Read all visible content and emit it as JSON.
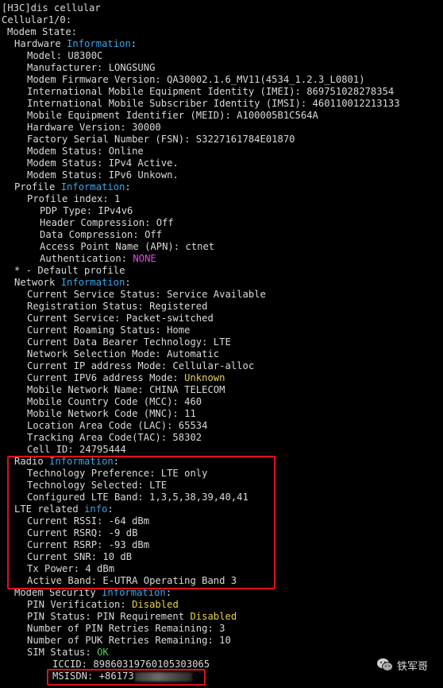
{
  "lines": [
    {
      "indent": "i0",
      "text": "[H3C]dis cellular"
    },
    {
      "indent": "i0",
      "text": "Cellular1/0:"
    },
    {
      "indent": "i1",
      "text": "Modem State:"
    },
    {
      "indent": "i2",
      "pre": "Hardware ",
      "hl": "Information",
      "hlc": "blue",
      "post": ":"
    },
    {
      "indent": "i3",
      "text": "Model: U8300C"
    },
    {
      "indent": "i3",
      "text": "Manufacturer: LONGSUNG"
    },
    {
      "indent": "i3",
      "text": "Modem Firmware Version: QA30002.1.6_MV11(4534_1.2.3_L0801)"
    },
    {
      "indent": "i3",
      "text": "International Mobile Equipment Identity (IMEI): 869751028278354"
    },
    {
      "indent": "i3",
      "text": "International Mobile Subscriber Identity (IMSI): 460110012213133"
    },
    {
      "indent": "i3",
      "text": "Mobile Equipment Identifier (MEID): A100005B1C564A"
    },
    {
      "indent": "i3",
      "text": "Hardware Version: 30000"
    },
    {
      "indent": "i3",
      "text": "Factory Serial Number (FSN): S3227161784E01870"
    },
    {
      "indent": "i3",
      "text": "Modem Status: Online"
    },
    {
      "indent": "i3",
      "text": "Modem Status: IPv4 Active."
    },
    {
      "indent": "i3",
      "text": "Modem Status: IPv6 Unkown."
    },
    {
      "indent": "i2",
      "pre": "Profile ",
      "hl": "Information",
      "hlc": "blue",
      "post": ":"
    },
    {
      "indent": "i3",
      "text": "Profile index: 1"
    },
    {
      "indent": "i4",
      "text": "PDP Type: IPv4v6"
    },
    {
      "indent": "i4",
      "text": "Header Compression: Off"
    },
    {
      "indent": "i4",
      "text": "Data Compression: Off"
    },
    {
      "indent": "i4",
      "text": "Access Point Name (APN): ctnet"
    },
    {
      "indent": "i4",
      "pre": "Authentication: ",
      "hl": "NONE",
      "hlc": "magenta",
      "post": ""
    },
    {
      "indent": "i2",
      "text": "* - Default profile"
    },
    {
      "indent": "i2",
      "pre": "Network ",
      "hl": "Information",
      "hlc": "blue",
      "post": ":"
    },
    {
      "indent": "i3",
      "text": "Current Service Status: Service Available"
    },
    {
      "indent": "i3",
      "text": "Registration Status: Registered"
    },
    {
      "indent": "i3",
      "text": "Current Service: Packet-switched"
    },
    {
      "indent": "i3",
      "text": "Current Roaming Status: Home"
    },
    {
      "indent": "i3",
      "text": "Current Data Bearer Technology: LTE"
    },
    {
      "indent": "i3",
      "text": "Network Selection Mode: Automatic"
    },
    {
      "indent": "i3",
      "text": "Current IP address Mode: Cellular-alloc"
    },
    {
      "indent": "i3",
      "pre": "Current IPV6 address Mode: ",
      "hl": "Unknown",
      "hlc": "yellow",
      "post": ""
    },
    {
      "indent": "i3",
      "text": "Mobile Network Name: CHINA TELECOM"
    },
    {
      "indent": "i3",
      "text": "Mobile Country Code (MCC): 460"
    },
    {
      "indent": "i3",
      "text": "Mobile Network Code (MNC): 11"
    },
    {
      "indent": "i3",
      "text": "Location Area Code (LAC): 65534"
    },
    {
      "indent": "i3",
      "text": "Tracking Area Code(TAC): 58302"
    },
    {
      "indent": "i3",
      "text": "Cell ID: 24795444"
    },
    {
      "indent": "i2",
      "pre": "Radio ",
      "hl": "Information",
      "hlc": "blue",
      "post": ":"
    },
    {
      "indent": "i3",
      "text": "Technology Preference: LTE only"
    },
    {
      "indent": "i3",
      "text": "Technology Selected: LTE"
    },
    {
      "indent": "i3",
      "text": "Configured LTE Band: 1,3,5,38,39,40,41"
    },
    {
      "indent": "i2",
      "pre": "LTE related ",
      "hl": "info",
      "hlc": "blue",
      "post": ":"
    },
    {
      "indent": "i3",
      "text": "Current RSSI: -64 dBm"
    },
    {
      "indent": "i3",
      "text": "Current RSRQ: -9 dB"
    },
    {
      "indent": "i3",
      "text": "Current RSRP: -93 dBm"
    },
    {
      "indent": "i3",
      "text": "Current SNR: 10 dB"
    },
    {
      "indent": "i3",
      "text": "Tx Power: 4 dBm"
    },
    {
      "indent": "i3",
      "text": "Active Band: E-UTRA Operating Band 3"
    },
    {
      "indent": "i2",
      "pre": "Modem Security ",
      "hl": "Information",
      "hlc": "blue",
      "post": ":"
    },
    {
      "indent": "i3",
      "pre": "PIN Verification: ",
      "hl": "Disabled",
      "hlc": "yellow",
      "post": ""
    },
    {
      "indent": "i3",
      "pre": "PIN Status: PIN Requirement ",
      "hl": "Disabled",
      "hlc": "yellow",
      "post": ""
    },
    {
      "indent": "i3",
      "text": "Number of PIN Retries Remaining: 3"
    },
    {
      "indent": "i3",
      "text": "Number of PUK Retries Remaining: 10"
    },
    {
      "indent": "i3",
      "pre": "SIM Status: ",
      "hl": "OK",
      "hlc": "green",
      "post": ""
    },
    {
      "indent": "i5",
      "text": "ICCID: 89860319760105303065"
    },
    {
      "indent": "i5",
      "text": "MSISDN: +86173",
      "redacted": true
    }
  ],
  "watermark": {
    "text": "铁军哥",
    "icon": "wechat-icon"
  },
  "colors": {
    "background": "#000000",
    "text": "#d9d9d9",
    "keyword": "#3aa6e6",
    "warning": "#e6d24a",
    "none": "#e64ae6",
    "ok": "#52d152",
    "highlight_box": "#e0101a"
  }
}
